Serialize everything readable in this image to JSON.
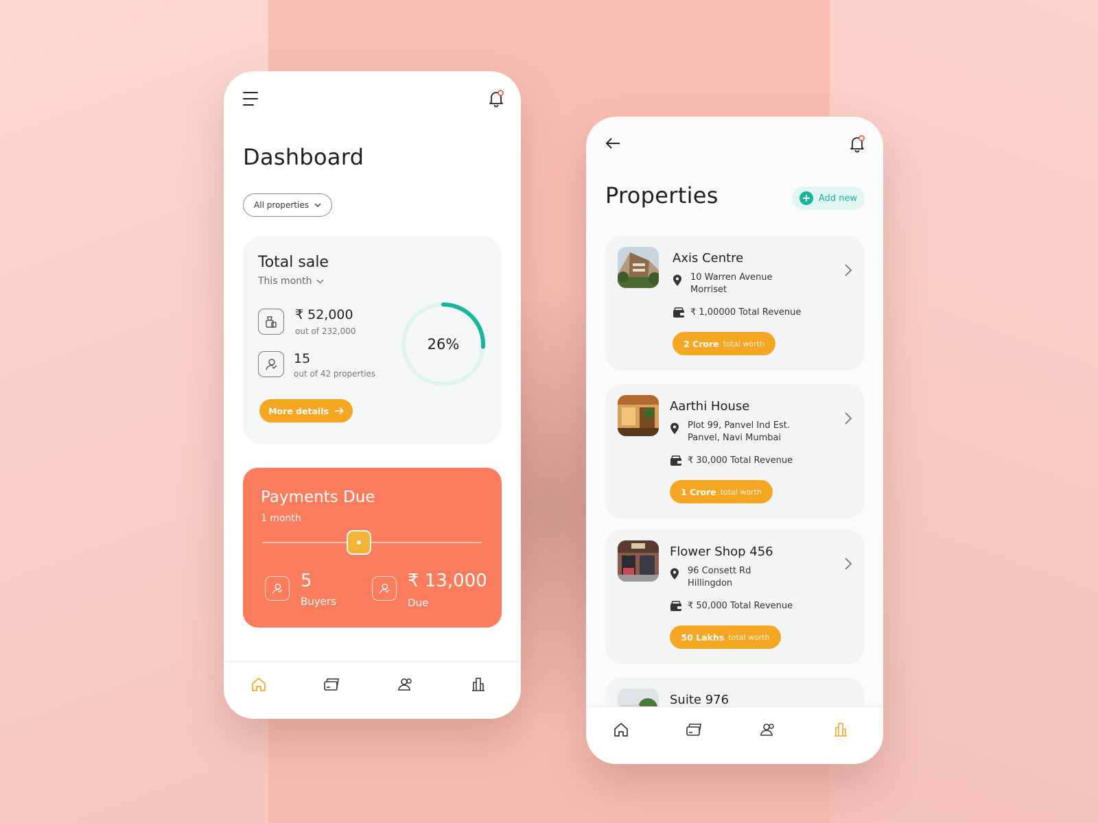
{
  "colors": {
    "accent_orange": "#f5a623",
    "coral": "#fb7c5c",
    "teal": "#16b79a",
    "background": "#f7cdc5"
  },
  "dashboard": {
    "title": "Dashboard",
    "filter_label": "All properties",
    "total_sale": {
      "title": "Total sale",
      "period": "This month",
      "amount": "₹ 52,000",
      "amount_sub": "out of 232,000",
      "count": "15",
      "count_sub": "out of 42 properties",
      "percent_label": "26%",
      "percent_value": 0.26,
      "more_label": "More details"
    },
    "payments_due": {
      "title": "Payments Due",
      "period": "1 month",
      "slider_value": 0.44,
      "buyers_value": "5",
      "buyers_label": "Buyers",
      "due_value": "₹ 13,000",
      "due_label": "Due"
    },
    "tabs": [
      "home-icon",
      "cards-icon",
      "users-icon",
      "building-icon"
    ],
    "active_tab": 0
  },
  "properties": {
    "title": "Properties",
    "add_label": "Add new",
    "items": [
      {
        "name": "Axis Centre",
        "address_line1": "10 Warren Avenue",
        "address_line2": "Morriset",
        "revenue": "₹ 1,00000 Total Revenue",
        "worth_value": "2 Crore",
        "worth_label": "total worth"
      },
      {
        "name": "Aarthi House",
        "address_line1": "Plot 99, Panvel Ind Est.",
        "address_line2": "Panvel, Navi Mumbai",
        "revenue": "₹ 30,000 Total Revenue",
        "worth_value": "1 Crore",
        "worth_label": "total worth"
      },
      {
        "name": "Flower Shop 456",
        "address_line1": "96  Consett Rd",
        "address_line2": "Hillingdon",
        "revenue": "₹ 50,000 Total Revenue",
        "worth_value": "50 Lakhs",
        "worth_label": "total worth"
      },
      {
        "name": "Suite 976"
      }
    ],
    "tabs": [
      "home-icon",
      "cards-icon",
      "users-icon",
      "building-icon"
    ],
    "active_tab": 3
  }
}
